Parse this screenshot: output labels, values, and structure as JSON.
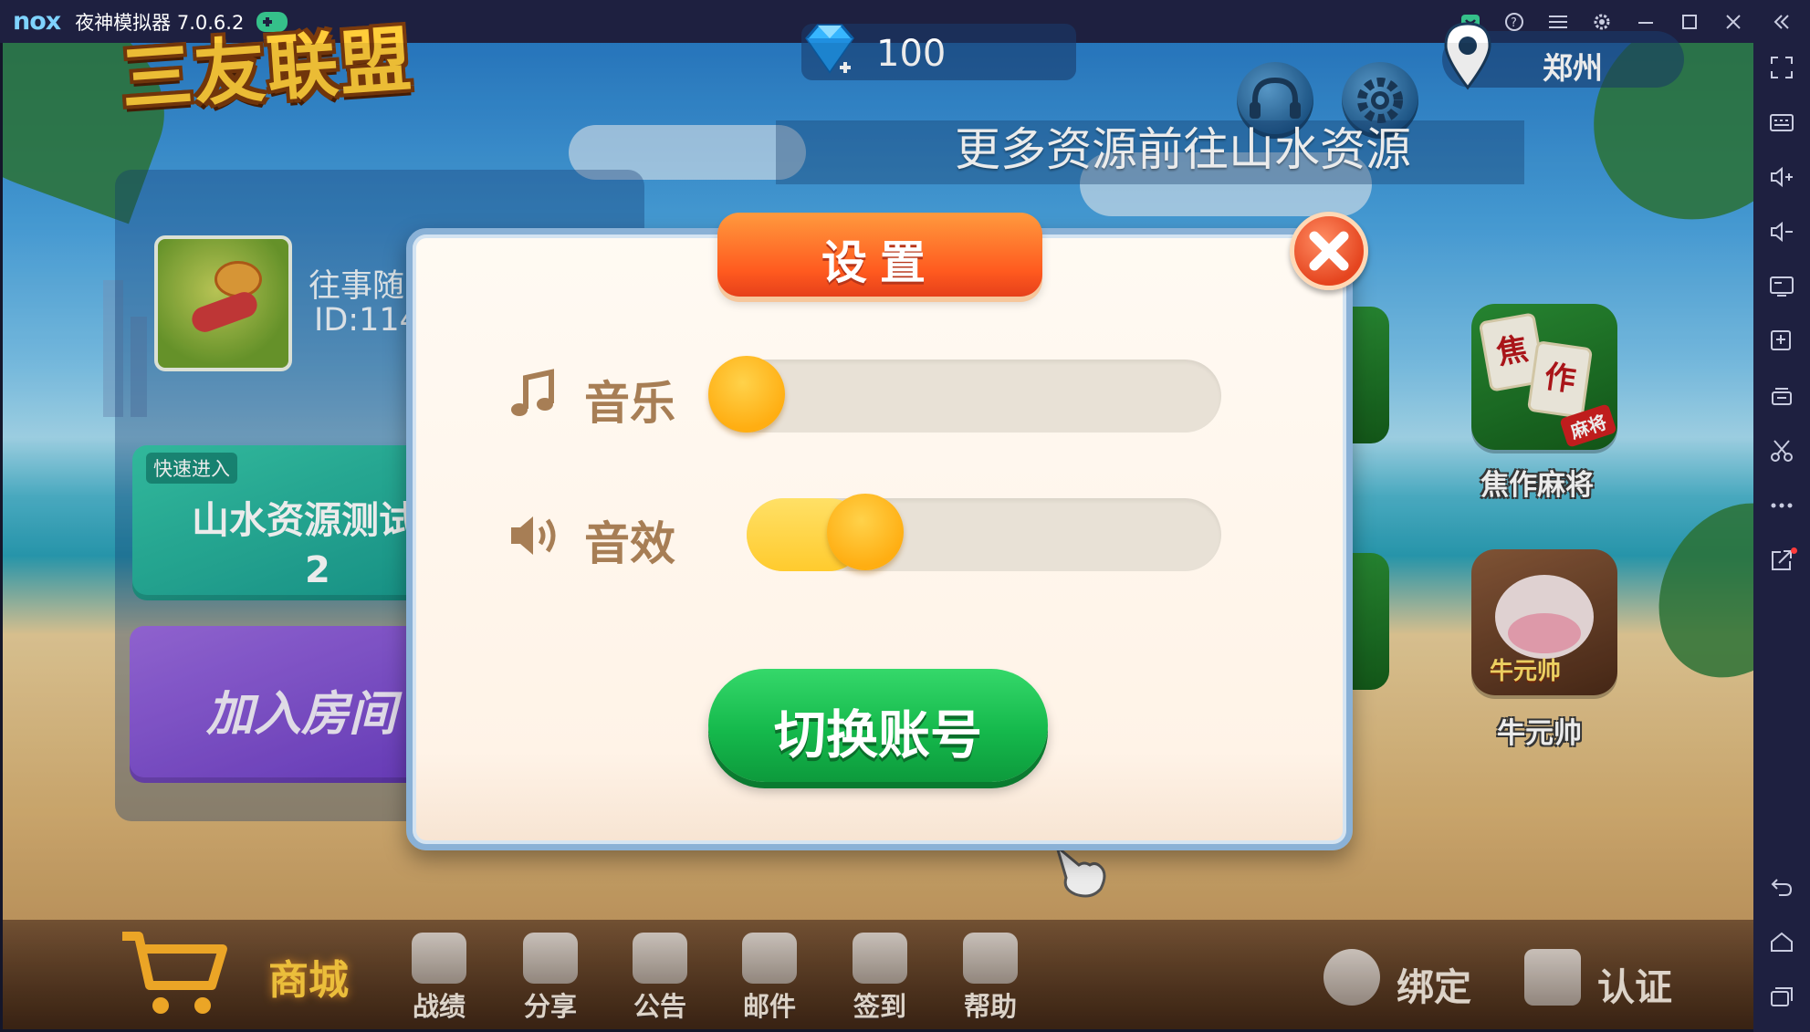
{
  "window": {
    "logo": "nox",
    "title": "夜神模拟器 7.0.6.2",
    "controls": [
      "app-store-icon",
      "help-icon",
      "menu-icon",
      "settings-icon",
      "minimize-icon",
      "maximize-icon",
      "close-icon",
      "collapse-sidebar-icon"
    ]
  },
  "sidebar": {
    "icons": [
      "fullscreen-icon",
      "keyboard-icon",
      "volume-up-icon",
      "volume-down-icon",
      "screen-icon",
      "install-apk-icon",
      "multi-instance-icon",
      "screenshot-icon",
      "more-icon",
      "share-icon",
      "back-icon",
      "home-icon",
      "recent-apps-icon"
    ]
  },
  "game": {
    "logo_text": "三友联盟",
    "diamonds": "100",
    "location": "郑州",
    "marquee": "更多资源前往山水资源",
    "player": {
      "name": "往事随",
      "id": "ID:114"
    },
    "quick_enter": {
      "tag": "快速进入",
      "room": "山水资源测试",
      "number": "2"
    },
    "join_room": "加入房间",
    "games": [
      {
        "label": "焦作麻将",
        "tile_chars": [
          "焦",
          "作"
        ],
        "ribbon": "麻将"
      },
      {
        "label": "牛元帅",
        "tile_text": "牛元帅"
      }
    ],
    "bottom": {
      "shop": "商城",
      "items": [
        "战绩",
        "分享",
        "公告",
        "邮件",
        "签到",
        "帮助"
      ],
      "bind": "绑定",
      "verify": "认证"
    }
  },
  "settings_dialog": {
    "title": "设置",
    "music": {
      "label": "音乐",
      "level": 0
    },
    "sound": {
      "label": "音效",
      "level": 0.25
    },
    "switch_account": "切换账号"
  },
  "colors": {
    "title_bar": "#1e2040",
    "dialog_header": "#ff5a1f",
    "button_green": "#15b94c",
    "slider_knob": "#ffae12",
    "label_brown": "#a77e55"
  }
}
